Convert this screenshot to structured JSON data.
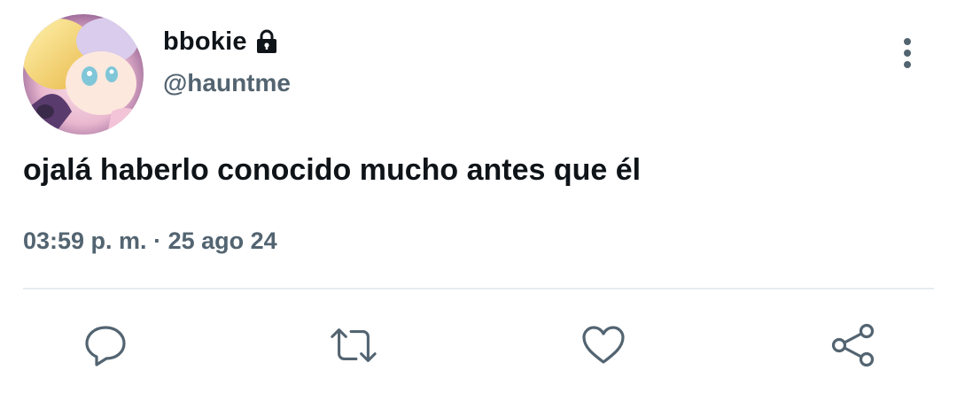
{
  "user": {
    "display_name": "bbokie",
    "handle": "@hauntme",
    "protected_icon": "lock-icon",
    "avatar": "anime-character-avatar"
  },
  "tweet": {
    "text": "ojalá haberlo conocido mucho antes que él",
    "time": "03:59 p. m.",
    "separator": "·",
    "date": "25 ago 24"
  },
  "actions": [
    {
      "icon": "reply-icon"
    },
    {
      "icon": "retweet-icon"
    },
    {
      "icon": "like-icon"
    },
    {
      "icon": "share-icon"
    }
  ],
  "menu": {
    "icon": "more-options-icon"
  },
  "colors": {
    "text_primary": "#0f1419",
    "text_secondary": "#536471",
    "icon": "#536471",
    "divider": "#e6ecf0"
  }
}
